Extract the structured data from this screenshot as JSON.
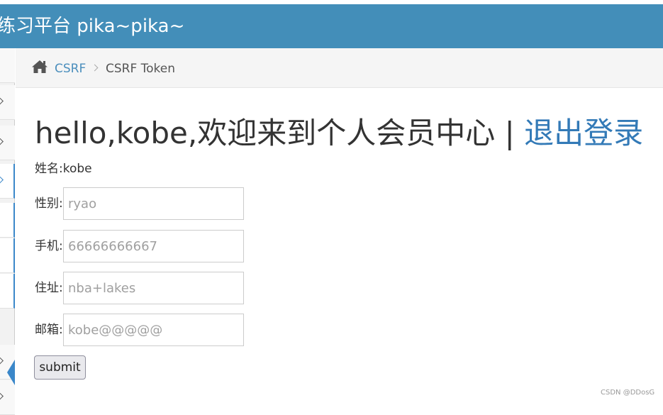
{
  "header": {
    "brand": "练习平台 pika~pika~"
  },
  "breadcrumb": {
    "home_icon": "home-icon",
    "link_label": "CSRF",
    "current_label": "CSRF Token"
  },
  "main": {
    "welcome_text": "hello,kobe,欢迎来到个人会员中心",
    "separator": "|",
    "logout_label": "退出登录",
    "name_line": "姓名:kobe",
    "fields": [
      {
        "label": "性别:",
        "value": "ryao"
      },
      {
        "label": "手机:",
        "value": "66666666667"
      },
      {
        "label": "住址:",
        "value": "nba+lakes"
      },
      {
        "label": "邮箱:",
        "value": "kobe@@@@@"
      }
    ],
    "submit_label": "submit"
  },
  "footer": {
    "watermark": "CSDN @DDosG"
  },
  "colors": {
    "navbar": "#438eb9",
    "link": "#337ab7",
    "breadcrumb_link": "#4c8fbd",
    "sidebar_active": "#3a87c9"
  }
}
